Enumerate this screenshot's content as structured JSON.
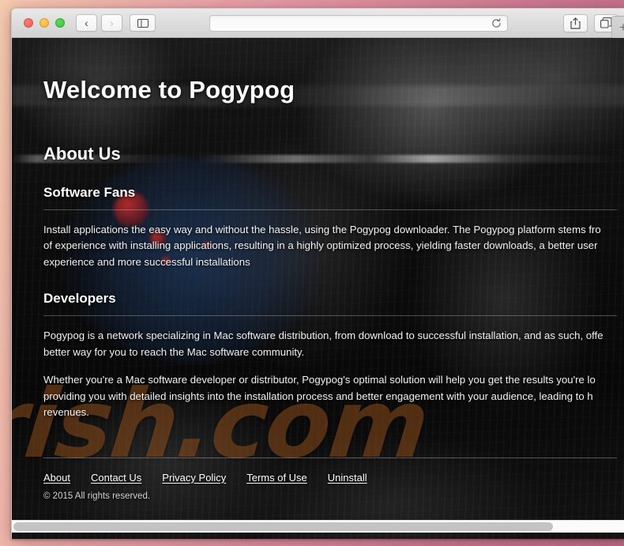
{
  "browser": {
    "traffic_lights": [
      "close",
      "minimize",
      "zoom"
    ],
    "nav": {
      "back_label": "‹",
      "forward_label": "›"
    },
    "sidebar_toggle": "sidebar-toggle",
    "address": {
      "value": "",
      "placeholder": ""
    },
    "reload": "reload",
    "share": "share",
    "tabs_overview": "tabs-overview",
    "new_tab_label": "+"
  },
  "page": {
    "hero_title": "Welcome to Pogypog",
    "about_heading": "About Us",
    "software_fans_heading": "Software Fans",
    "software_fans_paragraph": {
      "line1": "Install applications the easy way and without the hassle, using the Pogypog downloader. The Pogypog platform stems fro",
      "line2": "of experience with installing applications, resulting in a highly optimized process, yielding faster downloads, a better user",
      "line3": "experience and more successful installations"
    },
    "developers_heading": "Developers",
    "developers_paragraph_1": {
      "line1": "Pogypog is a network specializing in Mac software distribution, from download to successful installation, and as such, offe",
      "line2": "better way for you to reach the Mac software community."
    },
    "developers_paragraph_2": {
      "line1": "Whether you're a Mac software developer or distributor, Pogypog's optimal solution will help you get the results you're lo",
      "line2": "providing you with detailed insights into the installation process and better engagement with your audience, leading to h",
      "line3": "revenues."
    },
    "watermark_text": "rish.com",
    "footer": {
      "links": [
        {
          "label": "About"
        },
        {
          "label": "Contact Us"
        },
        {
          "label": "Privacy Policy"
        },
        {
          "label": "Terms of Use"
        },
        {
          "label": "Uninstall"
        }
      ],
      "copyright": "© 2015 All rights reserved."
    }
  },
  "colors": {
    "desktop_left": "#f6cdb0",
    "desktop_right": "#bf6b86",
    "page_background": "#0a0a0a",
    "text": "#ffffff",
    "watermark": "#c46822",
    "glow_blue": "#284e82",
    "dot_red": "#be2d2d"
  }
}
